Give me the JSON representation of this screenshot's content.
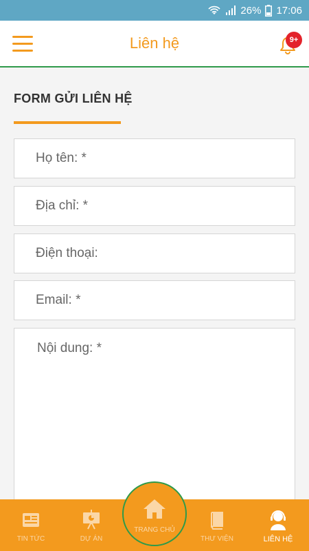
{
  "status_bar": {
    "battery": "26%",
    "time": "17:06",
    "icons": [
      "wifi-icon",
      "signal-icon",
      "battery-icon"
    ]
  },
  "header": {
    "title": "Liên hệ",
    "notification_badge": "9+",
    "icons": [
      "hamburger-menu-icon",
      "bell-icon"
    ]
  },
  "form": {
    "section_title": "FORM GỬI LIÊN HỆ",
    "fields": [
      {
        "placeholder": "Họ tên: *"
      },
      {
        "placeholder": "Địa chỉ: *"
      },
      {
        "placeholder": "Điện thoại:"
      },
      {
        "placeholder": "Email: *"
      },
      {
        "placeholder": "Nội dung: *"
      }
    ]
  },
  "bottom_nav": {
    "items": [
      {
        "label": "TIN TỨC",
        "icon": "newspaper-icon"
      },
      {
        "label": "DỰ ÁN",
        "icon": "presentation-icon"
      },
      {
        "label": "TRANG CHỦ",
        "icon": "home-icon"
      },
      {
        "label": "THƯ VIỆN",
        "icon": "book-icon"
      },
      {
        "label": "LIÊN HỆ",
        "icon": "support-agent-icon"
      }
    ],
    "active": "LIÊN HỆ"
  },
  "colors": {
    "accent": "#f39a1e",
    "status_bar": "#5fa7c4",
    "header_border": "#2e9a4a",
    "badge": "#e3232b"
  }
}
